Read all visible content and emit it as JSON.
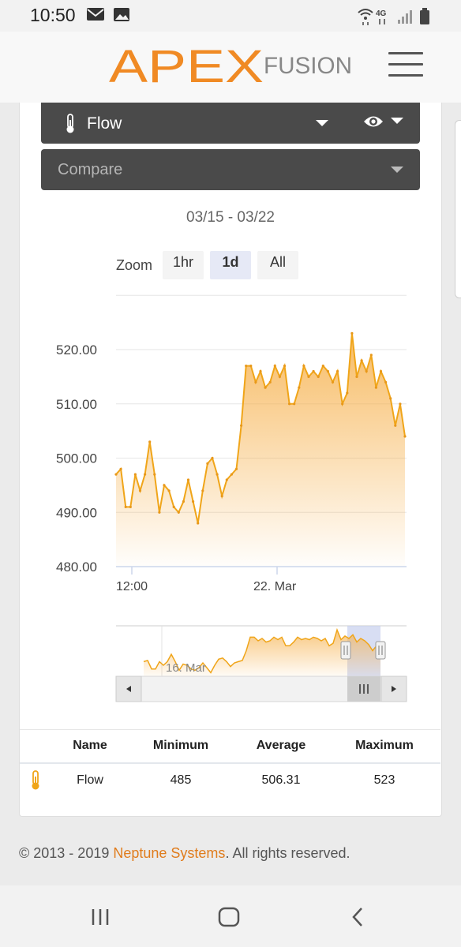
{
  "status_bar": {
    "time": "10:50",
    "left_icons": [
      "mail-icon",
      "image-icon"
    ],
    "right_icons": [
      "wifi-icon",
      "4g-icon",
      "signal-icon",
      "battery-icon"
    ],
    "network": "4G"
  },
  "header": {
    "logo_main": "APEX",
    "logo_sub": "FUSION",
    "menu_icon": "hamburger-menu-icon",
    "accent_color": "#f08a24"
  },
  "probe_select": {
    "label": "Flow",
    "icon": "thermometer-icon",
    "view_icon": "eye-icon"
  },
  "compare_select": {
    "placeholder": "Compare"
  },
  "date_range": "03/15 - 03/22",
  "zoom": {
    "label": "Zoom",
    "options": [
      "1hr",
      "1d",
      "All"
    ],
    "selected": "1d"
  },
  "chart_data": {
    "type": "area",
    "series": [
      {
        "name": "Flow",
        "color": "#f0a519",
        "x": [
          0,
          1,
          2,
          3,
          4,
          5,
          6,
          7,
          8,
          9,
          10,
          11,
          12,
          13,
          14,
          15,
          16,
          17,
          18,
          19,
          20,
          21,
          22,
          23,
          24,
          25,
          26,
          27,
          28,
          29,
          30,
          31,
          32,
          33,
          34,
          35,
          36,
          37,
          38,
          39,
          40,
          41,
          42,
          43,
          44,
          45,
          46,
          47,
          48,
          49,
          50,
          51,
          52,
          53,
          54,
          55,
          56,
          57,
          58,
          59,
          60
        ],
        "values": [
          497,
          498,
          491,
          491,
          497,
          494,
          497,
          503,
          497,
          490,
          495,
          494,
          491,
          490,
          492,
          496,
          492,
          488,
          494,
          499,
          500,
          497,
          493,
          496,
          497,
          498,
          506,
          517,
          517,
          514,
          516,
          513,
          514,
          517,
          515,
          517,
          510,
          510,
          513,
          517,
          515,
          516,
          515,
          517,
          516,
          514,
          516,
          510,
          512,
          523,
          515,
          518,
          516,
          519,
          513,
          516,
          514,
          511,
          506,
          510,
          504
        ]
      }
    ],
    "xaxis_ticks": [
      "12:00",
      "22. Mar"
    ],
    "yaxis_ticks": [
      "520.00",
      "510.00",
      "500.00",
      "490.00",
      "480.00"
    ],
    "ylim": [
      478,
      528
    ],
    "grid": true,
    "navigator_label": "16. Mar"
  },
  "stats_table": {
    "columns": [
      "Name",
      "Minimum",
      "Average",
      "Maximum"
    ],
    "rows": [
      {
        "icon": "thermometer-icon",
        "name": "Flow",
        "minimum": "485",
        "average": "506.31",
        "maximum": "523"
      }
    ]
  },
  "footer": {
    "prefix": "© 2013 - 2019 ",
    "company": "Neptune Systems",
    "suffix": ". All rights reserved."
  },
  "nav_bar": {
    "buttons": [
      "recent-apps-icon",
      "home-icon",
      "back-icon"
    ]
  }
}
